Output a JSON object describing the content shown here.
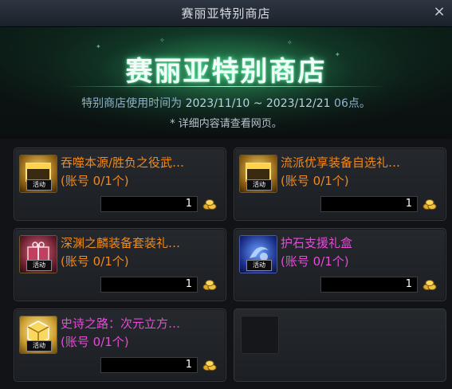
{
  "window": {
    "title": "赛丽亚特别商店",
    "close_label": "×"
  },
  "banner": {
    "shop_title": "赛丽亚特别商店",
    "period_prefix": "特别商店使用时间为 ",
    "period_dates": "2023/11/10 ~ 2023/12/21",
    "period_suffix": " 06点。",
    "note": "* 详细内容请查看网页。"
  },
  "items": [
    {
      "name": "吞噬本源/胜负之役武…",
      "limit": "(账号 0/1个)",
      "quantity": "1",
      "tag": "活动",
      "name_color": "#f08a1e",
      "icon": "gold-chest-icon"
    },
    {
      "name": "流派优享装备自选礼…",
      "limit": "(账号 0/1个)",
      "quantity": "1",
      "tag": "活动",
      "name_color": "#f08a1e",
      "icon": "gold-chest-icon"
    },
    {
      "name": "深渊之麟装备套装礼…",
      "limit": "(账号 0/1个)",
      "quantity": "1",
      "tag": "活动",
      "name_color": "#f08a1e",
      "icon": "gift-box-icon"
    },
    {
      "name": "护石支援礼盒",
      "limit": "(账号 0/1个)",
      "quantity": "1",
      "tag": "活动",
      "name_color": "#e64bd8",
      "icon": "blue-orb-icon"
    },
    {
      "name": "史诗之路：次元立方…",
      "limit": "(账号 0/1个)",
      "quantity": "1",
      "tag": "活动",
      "name_color": "#e64bd8",
      "icon": "golden-cube-icon"
    }
  ],
  "colors": {
    "orange": "#f08a1e",
    "purple": "#e64bd8",
    "banner_glow": "#6fffc0"
  }
}
